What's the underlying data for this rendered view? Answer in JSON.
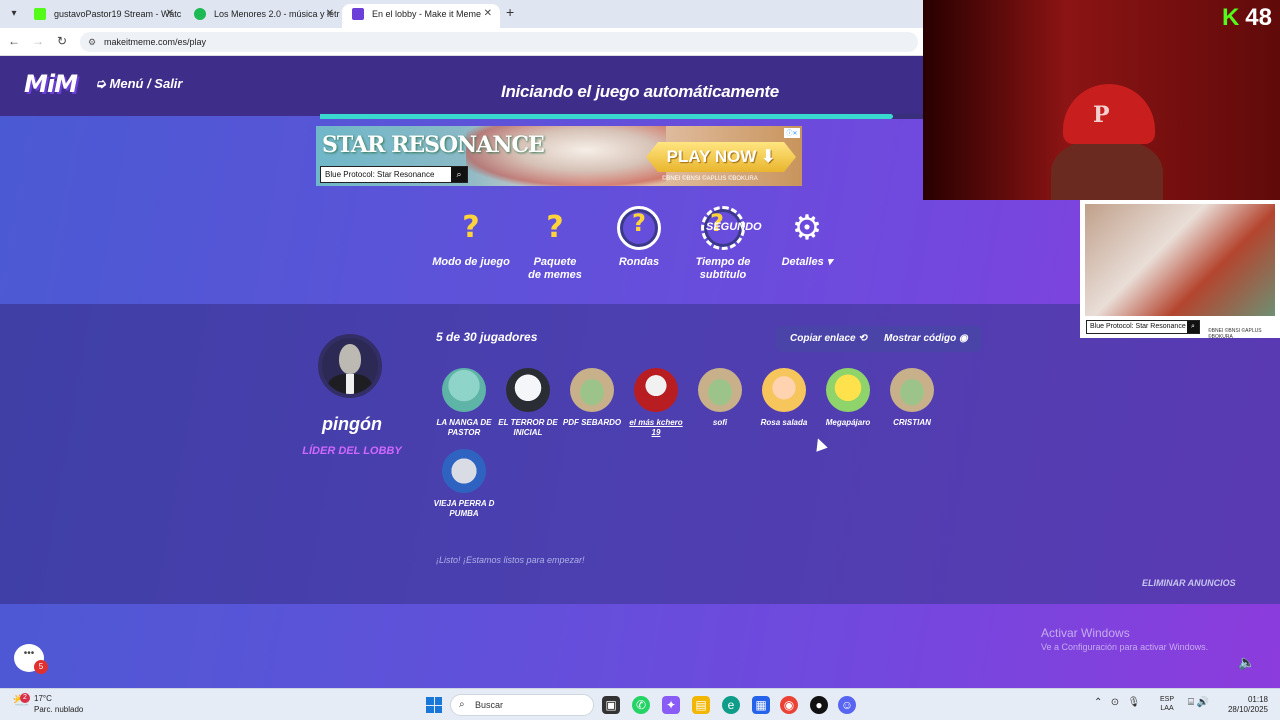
{
  "browser": {
    "tabs": [
      {
        "label": "gustavoPastor19 Stream - Watc",
        "color": "#53fc18"
      },
      {
        "label": "Los Menores 2.0 - música y letr",
        "color": "#1db954"
      },
      {
        "label": "En el lobby - Make it Meme",
        "color": "#6b3fd8"
      }
    ],
    "url": "makeitmeme.com/es/play"
  },
  "game": {
    "logo": "MiM",
    "menu_link": "Menú / Salir",
    "status_title": "Iniciando el juego automáticamente",
    "start_progress": 0.95,
    "ad": {
      "logo": "STAR RESONANCE",
      "cta": "PLAY NOW ⬇",
      "search": "Blue Protocol: Star Resonance",
      "copyright": "©BNEI ©BNSI ©APLUS ©BOKURA"
    },
    "settings": {
      "game_mode": "Modo de juego",
      "meme_pack_line1": "Paquete",
      "meme_pack_line2": "de memes",
      "rounds": "Rondas",
      "subtitle_time_line1": "Tiempo de",
      "subtitle_time_line2": "subtítulo",
      "subtitle_time_value": "SEGUNDO",
      "details": "Detalles"
    },
    "leader": {
      "name": "pingón",
      "role": "LÍDER DEL LOBBY"
    },
    "players_count": "5 de  30 jugadores",
    "copy_link": "Copiar enlace",
    "show_code": "Mostrar código",
    "players": [
      {
        "name": "LA NANGA DE PASTOR",
        "avatar": "squidward"
      },
      {
        "name": "EL TERROR DE INICIAL",
        "avatar": "penguin"
      },
      {
        "name": "PDF SEBARDO",
        "avatar": "baby-yoda"
      },
      {
        "name": "el más kchero 19",
        "avatar": "vampire"
      },
      {
        "name": "sofi",
        "avatar": "baby-yoda"
      },
      {
        "name": "Rosa salada",
        "avatar": "pink-girl"
      },
      {
        "name": "Megapájaro",
        "avatar": "pikachu"
      },
      {
        "name": "CRISTIAN",
        "avatar": "baby-yoda"
      },
      {
        "name": "VIEJA PERRA D PUMBA",
        "avatar": "thomas-train"
      }
    ],
    "ready_text": "¡Listo! ¡Estamos listos para empezar!",
    "remove_ads": "ELIMINAR ANUNCIOS",
    "chat_badge": "5"
  },
  "overlay": {
    "kick_viewers": "48",
    "side_ad_search": "Blue Protocol: Star Resonance",
    "side_ad_copy": "©BNEI ©BNSI ©APLUS ©BOKURA"
  },
  "windows_activation": {
    "line1": "Activar Windows",
    "line2": "Ve a Configuración para activar Windows."
  },
  "taskbar": {
    "temperature": "17°C",
    "weather": "Parc. nublado",
    "weather_badge": "2",
    "search_placeholder": "Buscar",
    "lang_line1": "ESP",
    "lang_line2": "LAA",
    "time": "01:18",
    "date": "28/10/2025"
  }
}
